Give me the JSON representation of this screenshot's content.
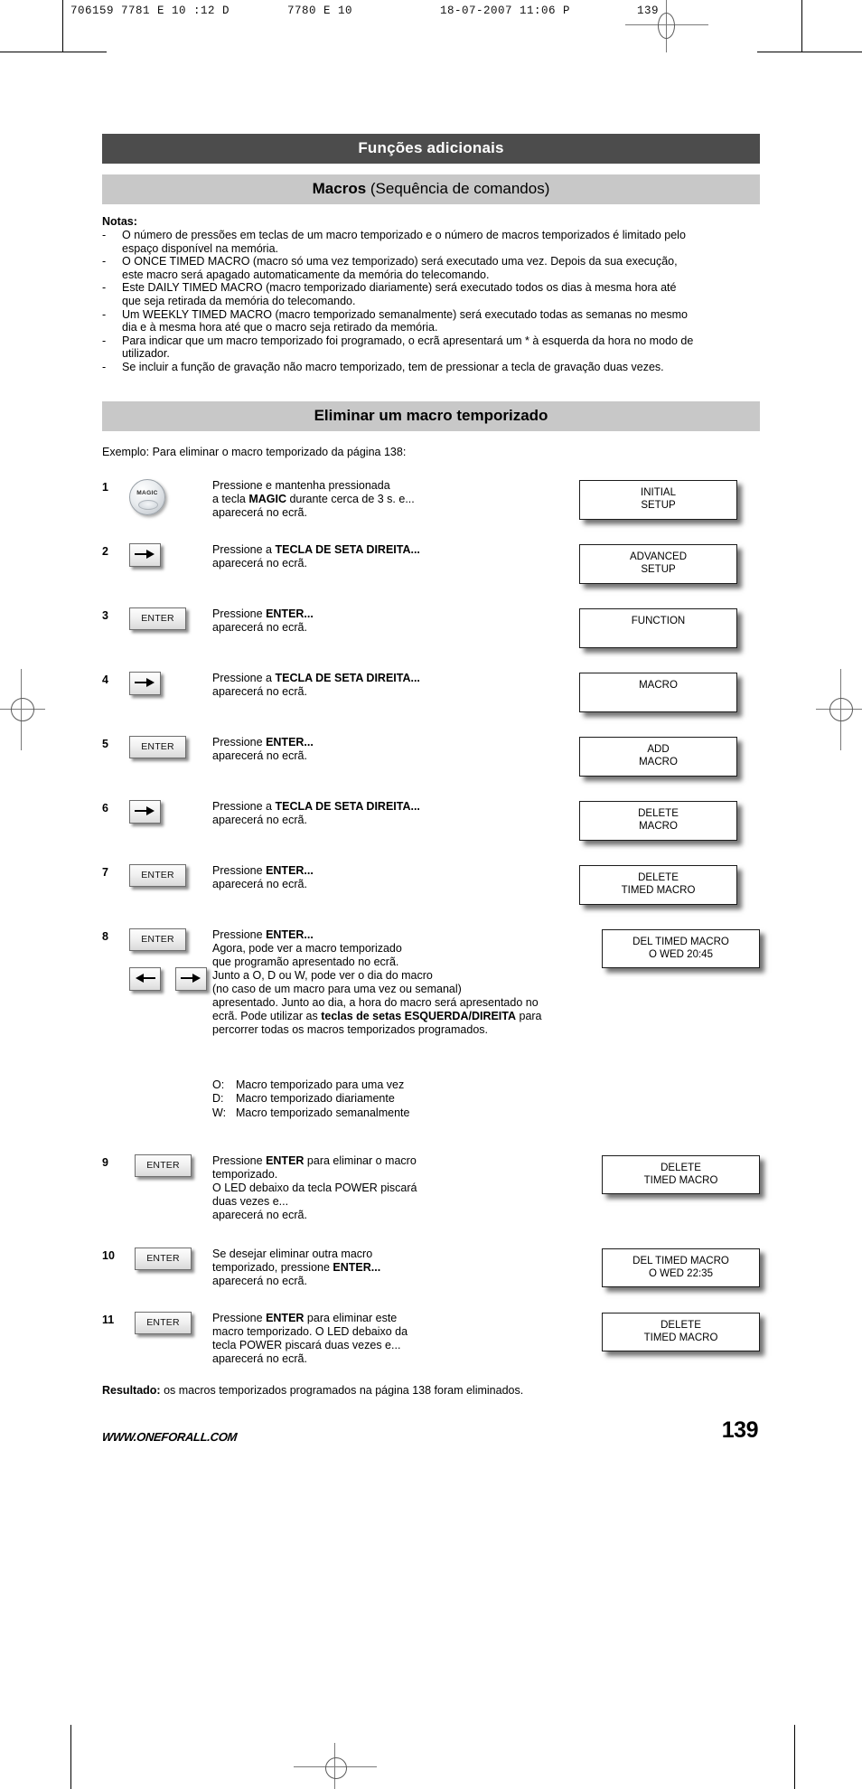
{
  "print_strip": {
    "col1": "706159  7781  E 10 :12 D",
    "col2": "7780  E      10",
    "col3": "18-07-2007   11:06   P",
    "col4": "139"
  },
  "section": {
    "header": "Funções adicionais",
    "subtitle_bold": "Macros",
    "subtitle_rest": " (Sequência de comandos)"
  },
  "notes": {
    "title": "Notas:",
    "dash": "-",
    "items": [
      "O número de pressões em teclas de um macro temporizado e o número de macros temporizados é limitado pelo espaço disponível na memória.",
      "O ONCE TIMED MACRO (macro só uma vez temporizado) será executado uma vez. Depois da sua execução, este macro será apagado automaticamente da memória do telecomando.",
      "Este DAILY TIMED MACRO (macro temporizado diariamente) será executado todos os dias à mesma hora até que seja retirada da memória do telecomando.",
      "Um WEEKLY TIMED MACRO (macro temporizado semanalmente) será executado todas as semanas no mesmo dia e à mesma hora até que o macro seja retirado da memória.",
      "Para indicar que um macro temporizado foi programado, o ecrã apresentará um * à esquerda da hora no modo de utilizador.",
      "Se incluir a função de gravação não macro temporizado, tem de pressionar a tecla de gravação duas vezes."
    ]
  },
  "procedure": {
    "title": "Eliminar um macro temporizado",
    "example": "Exemplo: Para eliminar o macro temporizado da página 138:",
    "steps": [
      {
        "num": "1",
        "key": "magic",
        "key_label": "MAGIC",
        "desc_html": "Pressione e mantenha pressionada<br>a tecla <b>MAGIC</b> durante cerca de 3 s. e...<br>aparecerá no ecrã.",
        "display": [
          "INITIAL",
          "SETUP"
        ]
      },
      {
        "num": "2",
        "key": "arrow-right",
        "key_label": "",
        "desc_html": "Pressione a <b>TECLA DE SETA DIREITA...</b><br>aparecerá no ecrã.",
        "display": [
          "ADVANCED",
          "SETUP"
        ]
      },
      {
        "num": "3",
        "key": "enter",
        "key_label": "ENTER",
        "desc_html": "Pressione <b>ENTER...</b><br>aparecerá no ecrã.",
        "display": [
          "FUNCTION"
        ]
      },
      {
        "num": "4",
        "key": "arrow-right",
        "key_label": "",
        "desc_html": "Pressione a <b>TECLA DE SETA DIREITA...</b><br>aparecerá no ecrã.",
        "display": [
          "MACRO"
        ]
      },
      {
        "num": "5",
        "key": "enter",
        "key_label": "ENTER",
        "desc_html": "Pressione <b>ENTER...</b><br>aparecerá no ecrã.",
        "display": [
          "ADD",
          "MACRO"
        ]
      },
      {
        "num": "6",
        "key": "arrow-right",
        "key_label": "",
        "desc_html": "Pressione a <b>TECLA DE SETA DIREITA...</b><br>aparecerá no ecrã.",
        "display": [
          "DELETE",
          "MACRO"
        ]
      },
      {
        "num": "7",
        "key": "enter",
        "key_label": "ENTER",
        "desc_html": "Pressione <b>ENTER...</b><br>aparecerá no ecrã.",
        "display": [
          "DELETE",
          "TIMED MACRO"
        ]
      },
      {
        "num": "8",
        "key": "enter-plus-arrows",
        "key_label": "ENTER",
        "desc_html": "Pressione <b>ENTER...</b><br>Agora, pode ver a macro temporizado<br>que programão apresentado no ecrã.<br>Junto a O, D ou W, pode ver o dia do macro<br>(no caso de um macro para uma vez ou semanal)<br>apresentado. Junto ao dia, a hora do macro será apresentado no<br>ecrã. Pode utilizar as <b>teclas de setas ESQUERDA/DIREITA</b> para<br>percorrer todas os macros temporizados programados.",
        "display": [
          "DEL TIMED MACRO",
          "O WED 20:45"
        ]
      },
      {
        "num": "9",
        "key": "enter",
        "key_label": "ENTER",
        "desc_html": "Pressione <b>ENTER</b> para eliminar o macro<br>temporizado.<br>O LED debaixo da tecla POWER piscará<br>duas vezes e...<br>aparecerá no ecrã.",
        "display": [
          "DELETE",
          "TIMED MACRO"
        ]
      },
      {
        "num": "10",
        "key": "enter",
        "key_label": "ENTER",
        "desc_html": "Se desejar eliminar outra macro<br>temporizado, pressione <b>ENTER...</b><br>aparecerá no ecrã.",
        "display": [
          "DEL TIMED MACRO",
          "O WED 22:35"
        ]
      },
      {
        "num": "11",
        "key": "enter",
        "key_label": "ENTER",
        "desc_html": "Pressione <b>ENTER</b> para eliminar este<br>macro temporizado. O LED debaixo da<br>tecla POWER piscará duas vezes e...<br>aparecerá no ecrã.",
        "display": [
          "DELETE",
          "TIMED MACRO"
        ]
      }
    ],
    "legend": [
      {
        "key": "O:",
        "text": "Macro temporizado para uma vez"
      },
      {
        "key": "D:",
        "text": "Macro temporizado diariamente"
      },
      {
        "key": "W:",
        "text": "Macro temporizado semanalmente"
      }
    ],
    "result_bold": "Resultado:",
    "result_rest": " os macros temporizados programados na página 138 foram eliminados."
  },
  "footer": {
    "url": "WWW.ONEFORALL.COM",
    "page": "139"
  },
  "colors": {
    "band_dark": "#4c4c4c",
    "band_light": "#c8c8c8",
    "text": "#000000"
  }
}
